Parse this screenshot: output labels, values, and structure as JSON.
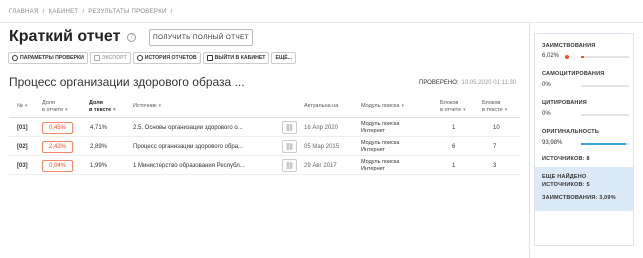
{
  "breadcrumb": {
    "items": [
      "ГЛАВНАЯ",
      "/",
      "КАБИНЕТ",
      "/",
      "РЕЗУЛЬТАТЫ ПРОВЕРКИ",
      "/"
    ]
  },
  "header": {
    "title": "Краткий отчет",
    "help": "?",
    "full_report_label": "ПОЛУЧИТЬ ПОЛНЫЙ ОТЧЕТ"
  },
  "toolbar": {
    "params": "ПАРАМЕТРЫ ПРОВЕРКИ",
    "export": "ЭКСПОРТ",
    "history": "ИСТОРИЯ ОТЧЕТОВ",
    "exit": "ВЫЙТИ В КАБИНЕТ",
    "more": "ЕЩЁ..."
  },
  "document": {
    "title": "Процесс организации здорового образа ...",
    "checked_label": "ПРОВЕРЕНО:",
    "checked_date": "10.05.2020 01:11:30"
  },
  "table": {
    "headers": {
      "num": "№",
      "share_report_1": "Доля",
      "share_report_2": "в отчете",
      "share_text_1": "Доля",
      "share_text_2": "в тексте",
      "source": "Источник",
      "actual": "Актуальна на",
      "module": "Модуль поиска",
      "blocks_report_1": "Блоков",
      "blocks_report_2": "в отчете",
      "blocks_text_1": "Блоков",
      "blocks_text_2": "в тексте"
    },
    "rows": [
      {
        "num": "[01]",
        "share_report": "0,45%",
        "share_text": "4,71%",
        "source": "2.5. Основы организации здорового о...",
        "date": "16 Апр 2020",
        "module1": "Модуль поиска",
        "module2": "Интернет",
        "blocks_report": "1",
        "blocks_text": "10"
      },
      {
        "num": "[02]",
        "share_report": "2,43%",
        "share_text": "2,89%",
        "source": "Процесс организации здорового обра...",
        "date": "05 Мар 2015",
        "module1": "Модуль поиска",
        "module2": "Интернет",
        "blocks_report": "6",
        "blocks_text": "7"
      },
      {
        "num": "[03]",
        "share_report": "0,04%",
        "share_text": "1,99%",
        "source": "1 Министерство образования Республ...",
        "date": "29 Авг 2017",
        "module1": "Модуль поиска",
        "module2": "Интернет",
        "blocks_report": "1",
        "blocks_text": "3"
      }
    ]
  },
  "sidebar": {
    "borrow_label": "ЗАИМСТВОВАНИЯ",
    "borrow_value": "6,02%",
    "borrow_fraction": 0.06,
    "borrow_color": "#e8542c",
    "selfcite_label": "САМОЦИТИРОВАНИЯ",
    "selfcite_value": "0%",
    "cite_label": "ЦИТИРОВАНИЯ",
    "cite_value": "0%",
    "orig_label": "ОРИГИНАЛЬНОСТЬ",
    "orig_value": "93,98%",
    "orig_fraction": 0.94,
    "orig_color": "#3aa5d8",
    "sources_label": "ИСТОЧНИКОВ:",
    "sources_value": "8",
    "found_label_1": "ЕЩЕ НАЙДЕНО",
    "found_label_2": "ИСТОЧНИКОВ:",
    "found_sources": "5",
    "found_borrow_label": "ЗАИМСТВОВАНИЯ:",
    "found_borrow_value": "3,09%"
  }
}
